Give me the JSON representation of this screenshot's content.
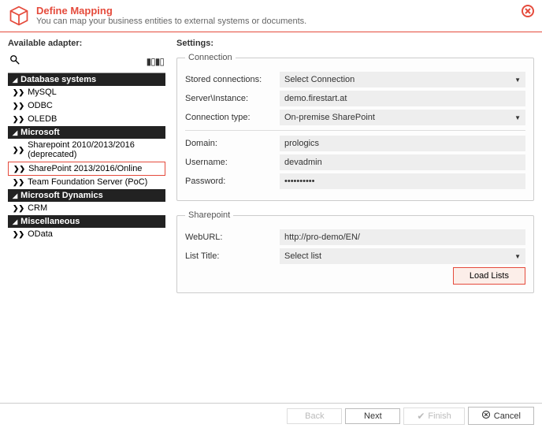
{
  "header": {
    "title": "Define Mapping",
    "subtitle": "You can map your business entities to external systems or documents."
  },
  "left": {
    "label": "Available adapter:"
  },
  "tree": {
    "groups": [
      {
        "label": "Database systems",
        "items": [
          {
            "label": "MySQL"
          },
          {
            "label": "ODBC"
          },
          {
            "label": "OLEDB"
          }
        ]
      },
      {
        "label": "Microsoft",
        "items": [
          {
            "label": "Sharepoint 2010/2013/2016 (deprecated)"
          },
          {
            "label": "SharePoint 2013/2016/Online",
            "selected": true
          },
          {
            "label": "Team Foundation Server (PoC)"
          }
        ]
      },
      {
        "label": "Microsoft Dynamics",
        "items": [
          {
            "label": "CRM"
          }
        ]
      },
      {
        "label": "Miscellaneous",
        "items": [
          {
            "label": "OData"
          }
        ]
      }
    ]
  },
  "settings": {
    "label": "Settings:",
    "connection": {
      "legend": "Connection",
      "stored_label": "Stored connections:",
      "stored_value": "Select Connection",
      "server_label": "Server\\Instance:",
      "server_value": "demo.firestart.at",
      "type_label": "Connection type:",
      "type_value": "On-premise SharePoint",
      "domain_label": "Domain:",
      "domain_value": "prologics",
      "user_label": "Username:",
      "user_value": "devadmin",
      "pass_label": "Password:",
      "pass_value": "••••••••••"
    },
    "sharepoint": {
      "legend": "Sharepoint",
      "weburl_label": "WebURL:",
      "weburl_value": "http://pro-demo/EN/",
      "list_label": "List Title:",
      "list_value": "Select list",
      "load_btn": "Load Lists"
    }
  },
  "footer": {
    "back": "Back",
    "next": "Next",
    "finish": "Finish",
    "cancel": "Cancel"
  }
}
